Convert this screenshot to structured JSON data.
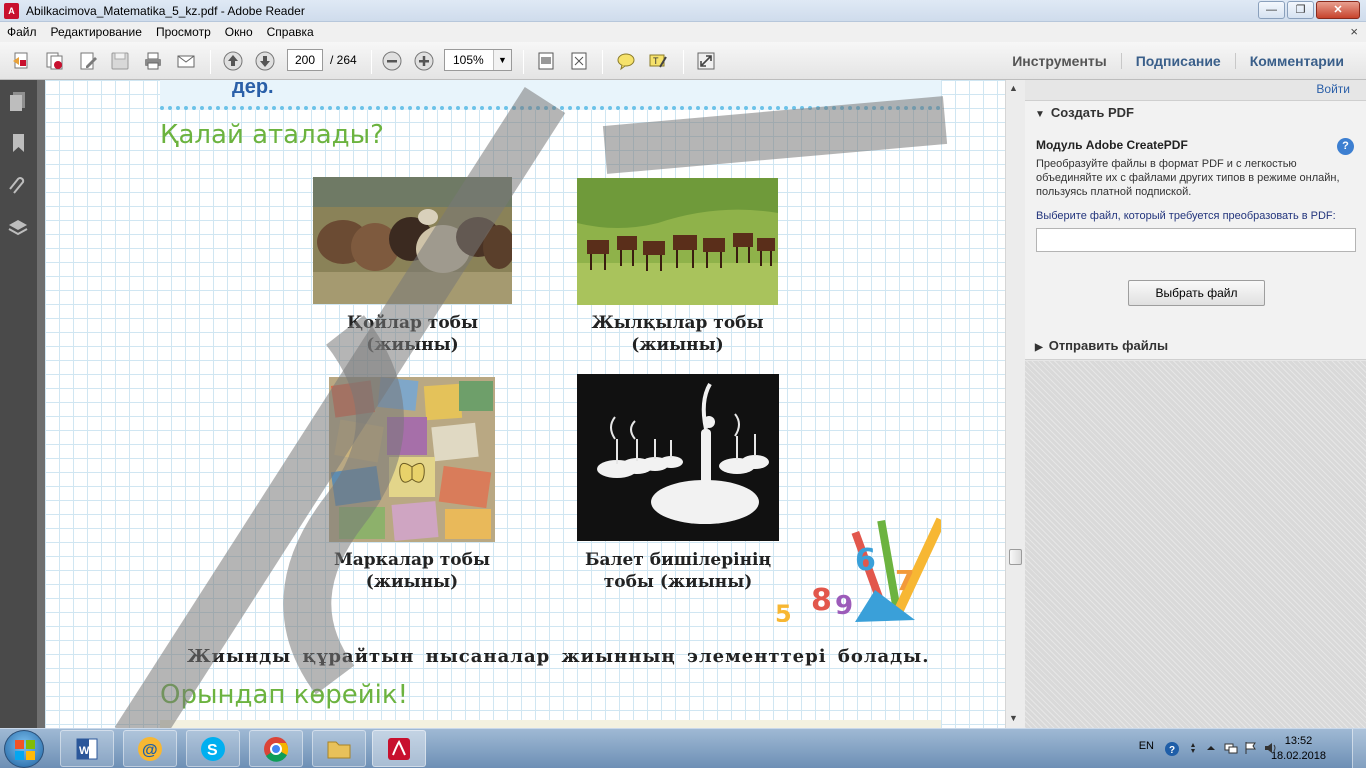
{
  "window": {
    "title": "Abilkacimova_Matematika_5_kz.pdf - Adobe Reader",
    "app_icon": "adobe-reader-icon"
  },
  "menu": {
    "items": [
      "Файл",
      "Редактирование",
      "Просмотр",
      "Окно",
      "Справка"
    ],
    "close_doc": "×"
  },
  "toolbar": {
    "page_current": "200",
    "page_total": "/ 264",
    "zoom": "105%",
    "tabs": [
      "Инструменты",
      "Подписание",
      "Комментарии"
    ]
  },
  "document": {
    "top_fragment": "дер.",
    "heading_1": "Қалай аталады?",
    "captions": [
      {
        "line1": "Қойлар тобы",
        "line2": "(жиыны)"
      },
      {
        "line1": "Жылқылар тобы",
        "line2": "(жиыны)"
      },
      {
        "line1": "Маркалар тобы",
        "line2": "(жиыны)"
      },
      {
        "line1": "Балет бишілерінің",
        "line2": "тобы (жиыны)"
      }
    ],
    "body": "Жиынды құрайтын нысаналар жиынның элементтері болады.",
    "heading_2": "Орындап көрейік!"
  },
  "right_panel": {
    "login": "Войти",
    "create_pdf": "Создать PDF",
    "module_title": "Модуль Adobe CreatePDF",
    "help": "?",
    "description": "Преобразуйте файлы в формат PDF и с легкостью объединяйте их с файлами других типов в режиме онлайн, пользуясь платной подпиской.",
    "choose_label": "Выберите файл, который требуется преобразовать в PDF:",
    "choose_button": "Выбрать файл",
    "send_files": "Отправить файлы"
  },
  "taskbar": {
    "lang": "EN",
    "time": "13:52",
    "date": "18.02.2018"
  },
  "colors": {
    "heading_green": "#6cb33f",
    "link_blue": "#2a5fa8",
    "nav_dark": "#4a4a4a",
    "taskbar": "#7f9fc3"
  }
}
